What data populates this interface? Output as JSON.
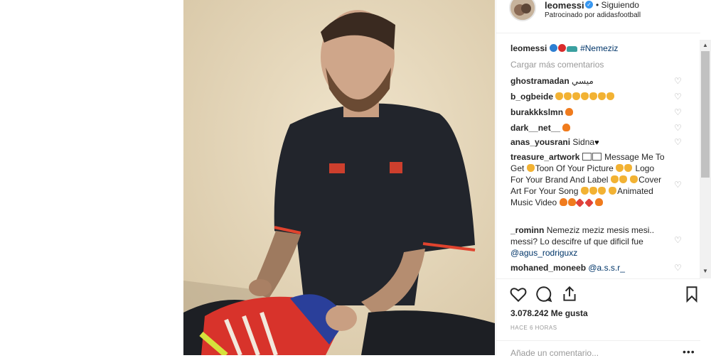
{
  "header": {
    "username": "leomessi",
    "follow_status": "• Siguiendo",
    "sponsored": "Patrocinado por adidasfootball"
  },
  "caption": {
    "user": "leomessi",
    "hashtag": "#Nemeziz",
    "emojis": [
      "blue-circle-emoji",
      "red-circle-emoji",
      "shoe-emoji"
    ]
  },
  "load_more": "Cargar más comentarios",
  "comments": [
    {
      "user": "ghostramadan",
      "text": "ميسي"
    },
    {
      "user": "b_ogbeide",
      "text": ""
    },
    {
      "user": "burakkkslmn",
      "text": ""
    },
    {
      "user": "dark__net__",
      "text": ""
    },
    {
      "user": "anas_yousrani",
      "text": "Sidna"
    },
    {
      "user": "treasure_artwork",
      "lines": [
        "Message Me",
        "To Get",
        "Toon Of Your Picture",
        "Logo For Your Brand And Label",
        "Cover Art For Your Song",
        "Animated Music Video"
      ]
    },
    {
      "user": "_rominn",
      "lines": [
        "Nemeziz meziz mesis mesi..",
        "messi? Lo descifre uf que dificil fue",
        "@agus_rodriguxz"
      ]
    },
    {
      "user": "mohaned_moneeb",
      "text": "@a.s.s.r_"
    }
  ],
  "likes": "3.078.242 Me gusta",
  "time": "HACE 6 HORAS",
  "add_comment_placeholder": "Añade un comentario...",
  "more": "•••"
}
